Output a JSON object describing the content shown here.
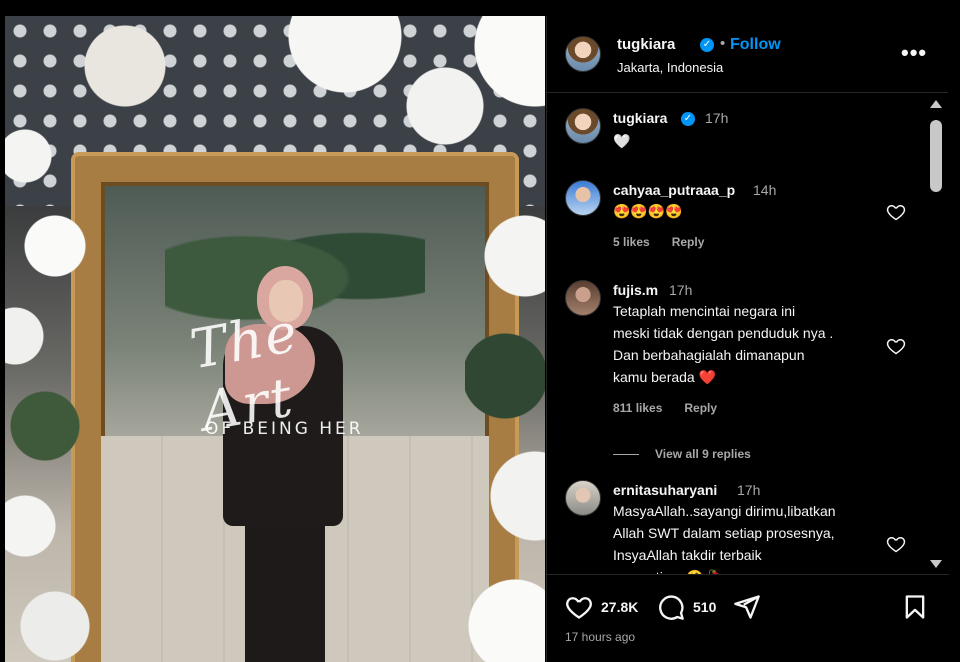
{
  "post": {
    "author": "tugkiara",
    "follow_label": "Follow",
    "separator": "•",
    "location": "Jakarta, Indonesia",
    "verified_mark": "✓",
    "more_icon": "more-horizontal-icon",
    "more_label": "•••"
  },
  "photo": {
    "overlay_script": "The Art",
    "overlay_caption": "OF BEING HER"
  },
  "comments": [
    {
      "user": "tugkiara",
      "time": "17h",
      "text": "🤍",
      "likes": "",
      "reply_label": ""
    },
    {
      "user": "cahyaa_putraaa_p",
      "time": "14h",
      "text": "😍😍😍😍",
      "likes": "5 likes",
      "reply_label": "Reply"
    },
    {
      "user": "fujis.m",
      "time": "17h",
      "text_lines": [
        "Tetaplah mencintai negara ini",
        "meski tidak dengan penduduk nya .",
        "Dan berbahagialah dimanapun",
        "kamu berada ❤️"
      ],
      "likes": "811 likes",
      "reply_label": "Reply",
      "view_replies": "View all 9 replies"
    },
    {
      "user": "ernitasuharyani",
      "time": "17h",
      "text_lines": [
        "MasyaAllah..sayangi dirimu,libatkan",
        "Allah SWT dalam setiap prosesnya,",
        "InsyaAllah takdir terbaik",
        "menantimu 🤗🥀"
      ]
    }
  ],
  "actions": {
    "likes_count": "27.8K",
    "comments_count": "510",
    "posted": "17 hours ago"
  },
  "colors": {
    "accent": "#0095f6",
    "background": "#000000",
    "muted": "#a8a8a8",
    "heart_red": "#ff3040"
  }
}
